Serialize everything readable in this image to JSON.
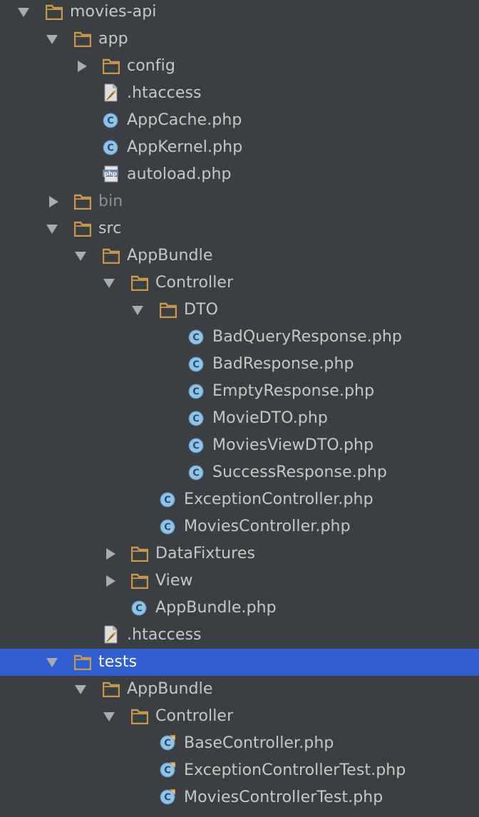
{
  "tree": {
    "items": [
      {
        "name": "movies-api",
        "type": "folder",
        "depth": 0,
        "expanded": true
      },
      {
        "name": "app",
        "type": "folder",
        "depth": 1,
        "expanded": true
      },
      {
        "name": "config",
        "type": "folder",
        "depth": 2,
        "expanded": false
      },
      {
        "name": ".htaccess",
        "type": "htaccess-file",
        "depth": 2
      },
      {
        "name": "AppCache.php",
        "type": "class-file",
        "depth": 2
      },
      {
        "name": "AppKernel.php",
        "type": "class-file",
        "depth": 2
      },
      {
        "name": "autoload.php",
        "type": "php-file",
        "depth": 2
      },
      {
        "name": "bin",
        "type": "folder",
        "depth": 1,
        "expanded": false,
        "dimmed": true
      },
      {
        "name": "src",
        "type": "folder",
        "depth": 1,
        "expanded": true
      },
      {
        "name": "AppBundle",
        "type": "folder",
        "depth": 2,
        "expanded": true
      },
      {
        "name": "Controller",
        "type": "folder",
        "depth": 3,
        "expanded": true
      },
      {
        "name": "DTO",
        "type": "folder",
        "depth": 4,
        "expanded": true
      },
      {
        "name": "BadQueryResponse.php",
        "type": "class-file",
        "depth": 5
      },
      {
        "name": "BadResponse.php",
        "type": "class-file",
        "depth": 5
      },
      {
        "name": "EmptyResponse.php",
        "type": "class-file",
        "depth": 5
      },
      {
        "name": "MovieDTO.php",
        "type": "class-file",
        "depth": 5
      },
      {
        "name": "MoviesViewDTO.php",
        "type": "class-file",
        "depth": 5
      },
      {
        "name": "SuccessResponse.php",
        "type": "class-file",
        "depth": 5
      },
      {
        "name": "ExceptionController.php",
        "type": "class-file",
        "depth": 4
      },
      {
        "name": "MoviesController.php",
        "type": "class-file",
        "depth": 4
      },
      {
        "name": "DataFixtures",
        "type": "folder",
        "depth": 3,
        "expanded": false
      },
      {
        "name": "View",
        "type": "folder",
        "depth": 3,
        "expanded": false
      },
      {
        "name": "AppBundle.php",
        "type": "class-file",
        "depth": 3
      },
      {
        "name": ".htaccess",
        "type": "htaccess-file",
        "depth": 2
      },
      {
        "name": "tests",
        "type": "folder",
        "depth": 1,
        "expanded": true,
        "selected": true
      },
      {
        "name": "AppBundle",
        "type": "folder",
        "depth": 2,
        "expanded": true
      },
      {
        "name": "Controller",
        "type": "folder",
        "depth": 3,
        "expanded": true
      },
      {
        "name": "BaseController.php",
        "type": "test-class-file",
        "depth": 4
      },
      {
        "name": "ExceptionControllerTest.php",
        "type": "test-class-file",
        "depth": 4
      },
      {
        "name": "MoviesControllerTest.php",
        "type": "test-class-file",
        "depth": 4
      }
    ]
  },
  "colors": {
    "background": "#3b3f41",
    "selection": "#2f5fd1",
    "text": "#c5c8c6",
    "dimmed_text": "#8d8f91",
    "folder": "#c7984f",
    "class_icon": "#8fc3e8",
    "arrow": "#a9abad"
  }
}
